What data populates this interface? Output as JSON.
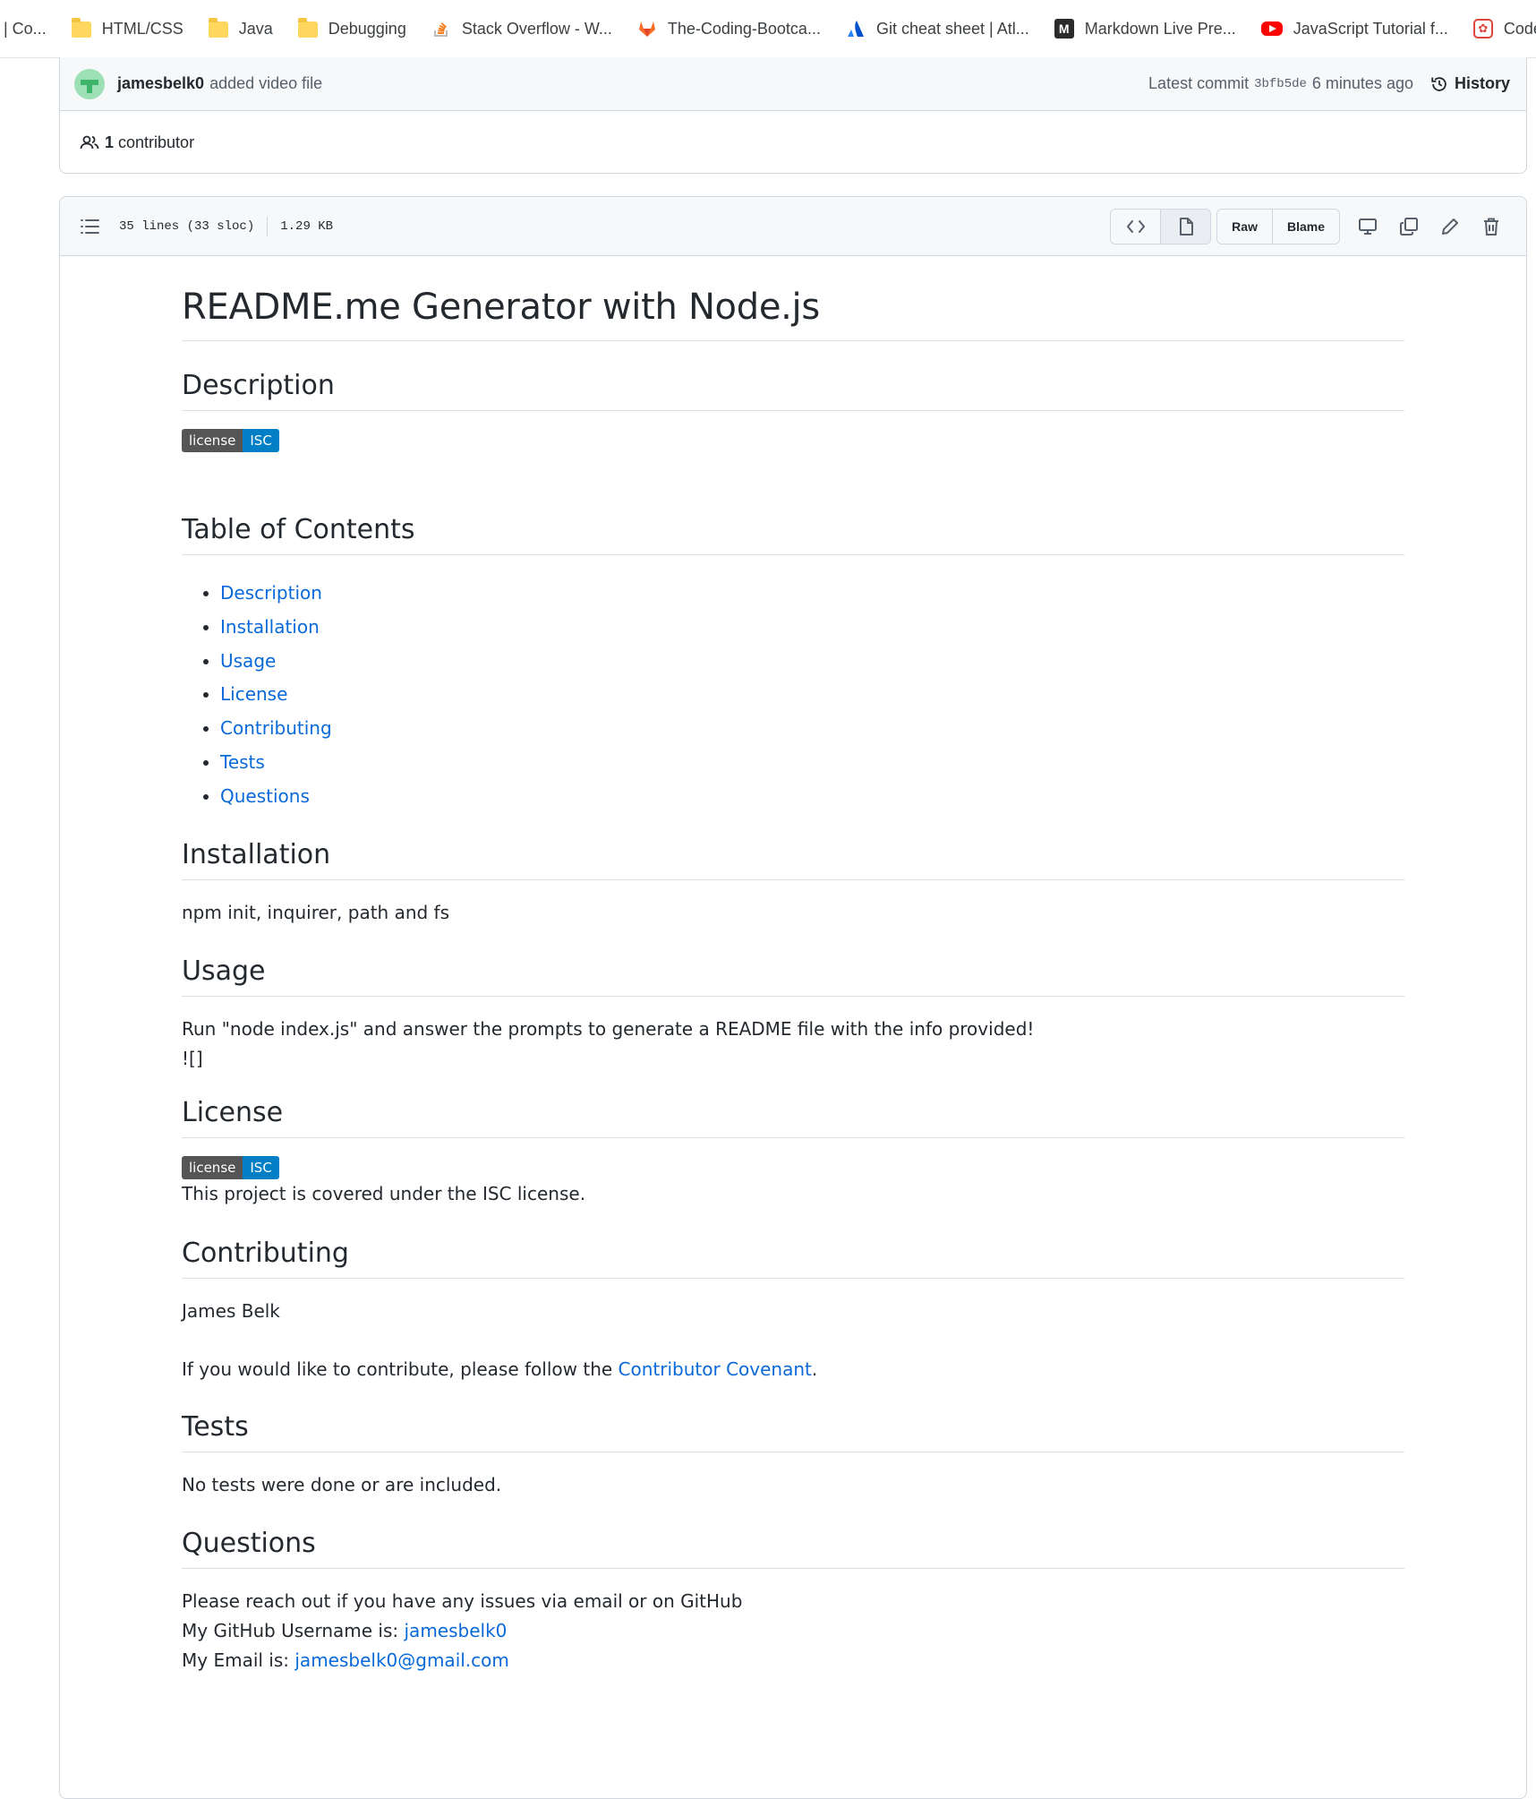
{
  "bookmarks": [
    {
      "label": "| Co...",
      "icon": "none"
    },
    {
      "label": "HTML/CSS",
      "icon": "folder-icon"
    },
    {
      "label": "Java",
      "icon": "folder-icon"
    },
    {
      "label": "Debugging",
      "icon": "folder-icon"
    },
    {
      "label": "Stack Overflow - W...",
      "icon": "stackoverflow-icon"
    },
    {
      "label": "The-Coding-Bootca...",
      "icon": "gitlab-icon"
    },
    {
      "label": "Git cheat sheet | Atl...",
      "icon": "atlassian-icon"
    },
    {
      "label": "Markdown Live Pre...",
      "icon": "markdown-icon"
    },
    {
      "label": "JavaScript Tutorial f...",
      "icon": "youtube-icon"
    },
    {
      "label": "Codewars",
      "icon": "codewars-icon"
    }
  ],
  "commit": {
    "user": "jamesbelk0",
    "message": "added video file",
    "latest_label": "Latest commit",
    "hash": "3bfb5de",
    "time": "6 minutes ago",
    "history_label": "History"
  },
  "contributors": {
    "count": "1",
    "label": "contributor"
  },
  "file": {
    "lines": "35 lines (33 sloc)",
    "size": "1.29 KB",
    "raw_label": "Raw",
    "blame_label": "Blame"
  },
  "readme": {
    "title": "README.me Generator with Node.js",
    "badge_left": "license",
    "badge_right": "ISC",
    "description_heading": "Description",
    "toc_heading": "Table of Contents",
    "toc": [
      "Description",
      "Installation",
      "Usage",
      "License",
      "Contributing",
      "Tests",
      "Questions"
    ],
    "installation_heading": "Installation",
    "installation_text": "npm init, inquirer, path and fs",
    "usage_heading": "Usage",
    "usage_text": "Run \"node index.js\" and answer the prompts to generate a README file with the info provided!",
    "usage_image_text": "![]",
    "license_heading": "License",
    "license_text": "This project is covered under the ISC license.",
    "contributing_heading": "Contributing",
    "contributing_name": "James Belk",
    "contributing_text_before": "If you would like to contribute, please follow the ",
    "contributing_link": "Contributor Covenant",
    "contributing_text_after": ".",
    "tests_heading": "Tests",
    "tests_text": "No tests were done or are included.",
    "questions_heading": "Questions",
    "questions_text": "Please reach out if you have any issues via email or on GitHub",
    "github_label": "My GitHub Username is: ",
    "github_user": "jamesbelk0",
    "email_label": "My Email is: ",
    "email": "jamesbelk0@gmail.com"
  },
  "colors": {
    "link": "#0969da",
    "badge_left": "#555555",
    "badge_right": "#007ec6"
  }
}
